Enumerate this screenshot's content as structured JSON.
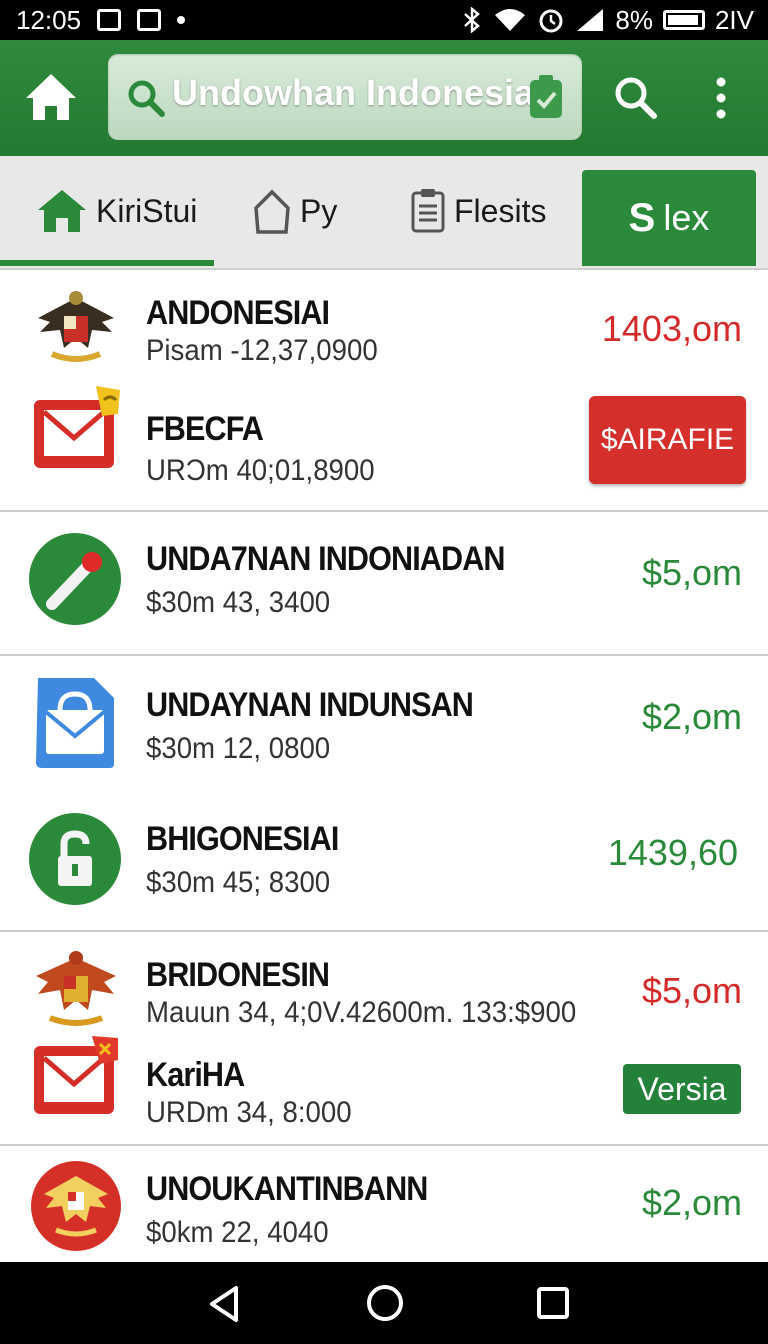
{
  "status_bar": {
    "time": "12:05",
    "battery": "8%",
    "network": "2IV"
  },
  "app_bar": {
    "search_text": "Undowhan Indonesia"
  },
  "tabs": [
    {
      "label": "KiriStui"
    },
    {
      "label": "Py"
    },
    {
      "label": "Flesits"
    }
  ],
  "active_tab": {
    "prefix": "S",
    "label": "lex"
  },
  "items": [
    {
      "title": "ANDONESIAI",
      "subtitle": "Pisam -12,37,0900",
      "amount": "1403,om",
      "amount_color": "#d42a2a",
      "icon": "garuda-emblem-icon"
    },
    {
      "title": "FBECFA",
      "subtitle": "URϽm 40;01,8900",
      "action": "$AIRAFIE",
      "icon": "mail-icon"
    },
    {
      "title": "UNDA7NAN INDONIADAN",
      "subtitle": "$30m 43, 3400",
      "amount": "$5,om",
      "amount_color": "#2a8a3a",
      "icon": "pin-tool-icon"
    },
    {
      "title": "UNDAYNAN INDUNSAN",
      "subtitle": "$30m 12, 0800",
      "amount": "$2,om",
      "amount_color": "#2a8a3a",
      "icon": "mail-bag-icon"
    },
    {
      "title": "BHIGONESIAI",
      "subtitle": "$30m 45; 8300",
      "amount": "1439,60",
      "amount_color": "#2a8a3a",
      "icon": "lock-icon"
    },
    {
      "title": "BRIDONESIN",
      "subtitle": "Mauun 34, 4;0V.42600m. 133:$900",
      "amount": "$5,om",
      "amount_color": "#d42a2a",
      "icon": "garuda-emblem-icon"
    },
    {
      "title": "KariHA",
      "subtitle": "URDm 34, 8:000",
      "action": "Versia",
      "icon": "mail-icon"
    },
    {
      "title": "UNOUKANTINBANN",
      "subtitle": "$0km 22, 4040",
      "amount": "$2,om",
      "amount_color": "#2a8a3a",
      "icon": "garuda-emblem-icon"
    }
  ],
  "colors": {
    "brand_green": "#2a8a3a",
    "alert_red": "#d42a2a"
  }
}
